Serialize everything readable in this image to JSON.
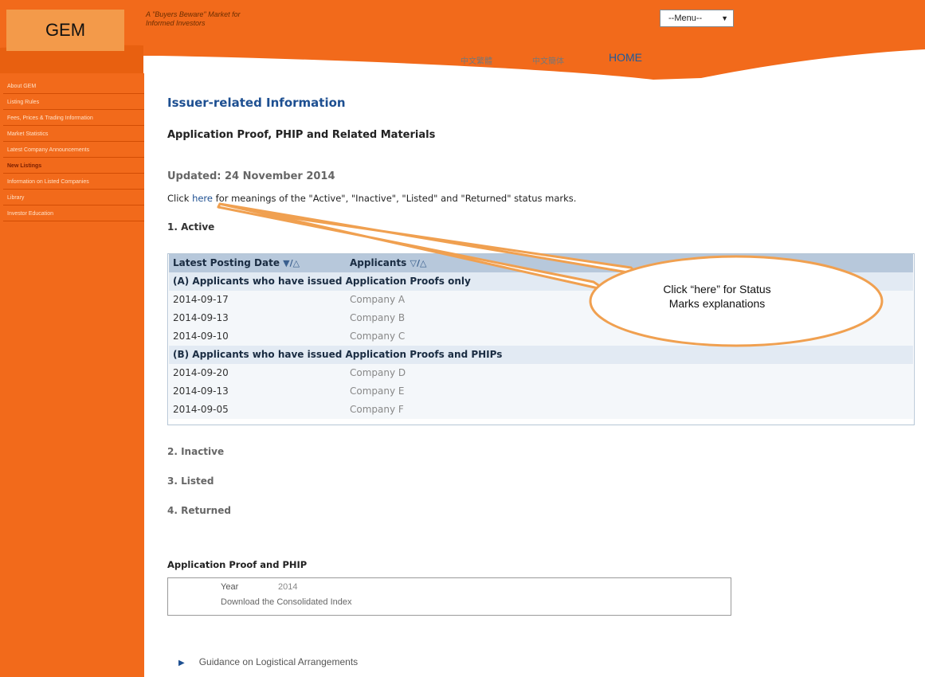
{
  "header": {
    "logo": "GEM",
    "tagline_line1": "A \"Buyers Beware\" Market for",
    "tagline_line2": "Informed Investors",
    "menu_select": "--Menu--",
    "links": {
      "trad_chinese": "中文繁體",
      "simp_chinese": "中文簡体",
      "home": "HOME"
    },
    "colors": {
      "orange": "#f26a1b",
      "logo_bg": "#f39a4a"
    }
  },
  "sidebar": {
    "items": [
      {
        "label": "About GEM"
      },
      {
        "label": "Listing Rules"
      },
      {
        "label": "Fees, Prices & Trading Information"
      },
      {
        "label": "Market Statistics"
      },
      {
        "label": "Latest Company Announcements"
      },
      {
        "label": "New Listings"
      },
      {
        "label": "Information on Listed Companies"
      },
      {
        "label": "Library"
      },
      {
        "label": "Investor Education"
      }
    ]
  },
  "main": {
    "title": "Issuer-related Information",
    "subtitle": "Application Proof, PHIP and Related Materials",
    "updated": "Updated: 24 November 2014",
    "click_prefix": "Click ",
    "click_link": "here",
    "click_suffix": " for meanings of the \"Active\", \"Inactive\", \"Listed\" and \"Returned\" status marks.",
    "sections": {
      "active": "1. Active",
      "inactive": "2. Inactive",
      "listed": "3. Listed",
      "returned": "4. Returned"
    },
    "table": {
      "col_date": "Latest Posting Date",
      "col_date_sort": "▼/△",
      "col_applicants": "Applicants",
      "col_applicants_sort": "▽/△",
      "group_a": "(A) Applicants who have issued Application Proofs only",
      "group_b": "(B) Applicants who have issued Application Proofs and PHIPs",
      "rows_a": [
        {
          "date": "2014-09-17",
          "applicant": "Company A"
        },
        {
          "date": "2014-09-13",
          "applicant": "Company B"
        },
        {
          "date": "2014-09-10",
          "applicant": "Company C"
        }
      ],
      "rows_b": [
        {
          "date": "2014-09-20",
          "applicant": "Company D"
        },
        {
          "date": "2014-09-13",
          "applicant": "Company E"
        },
        {
          "date": "2014-09-05",
          "applicant": "Company F"
        }
      ]
    },
    "proof_box": {
      "title": "Application Proof and PHIP",
      "year_label": "Year",
      "year_value": "2014",
      "download": "Download the Consolidated Index"
    },
    "guidance": "Guidance on Logistical Arrangements"
  },
  "callout": {
    "line1": "Click “here” for Status",
    "line2": "Marks explanations",
    "color": "#f0a050"
  }
}
